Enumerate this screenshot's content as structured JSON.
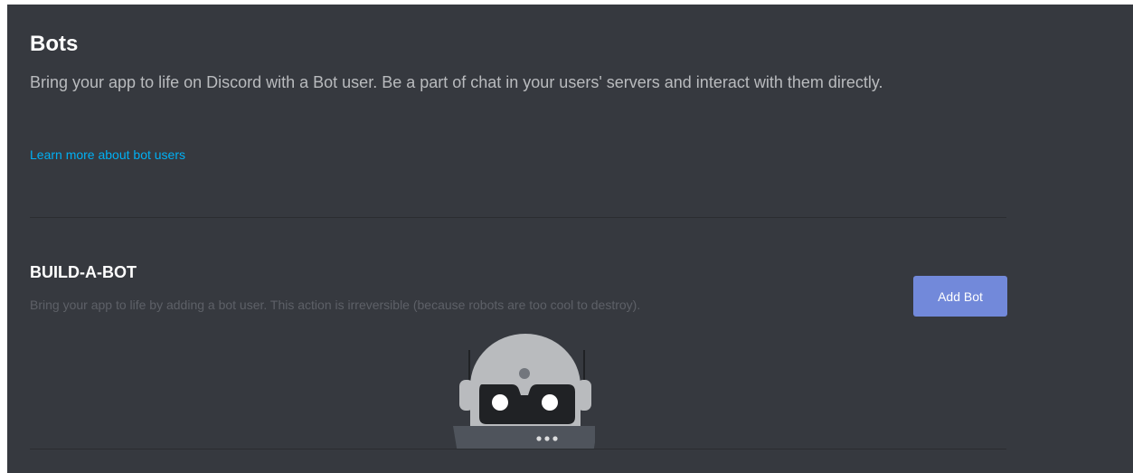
{
  "header": {
    "title": "Bots",
    "description": "Bring your app to life on Discord with a Bot user. Be a part of chat in your users' servers and interact with them directly.",
    "learn_more_link": "Learn more about bot users"
  },
  "build_a_bot": {
    "title": "BUILD-A-BOT",
    "description": "Bring your app to life by adding a bot user. This action is irreversible (because robots are too cool to destroy).",
    "add_bot_label": "Add Bot",
    "illustration_icon": "robot-icon"
  },
  "colors": {
    "background": "#36393f",
    "accent": "#7289da",
    "link": "#00b0f4"
  }
}
